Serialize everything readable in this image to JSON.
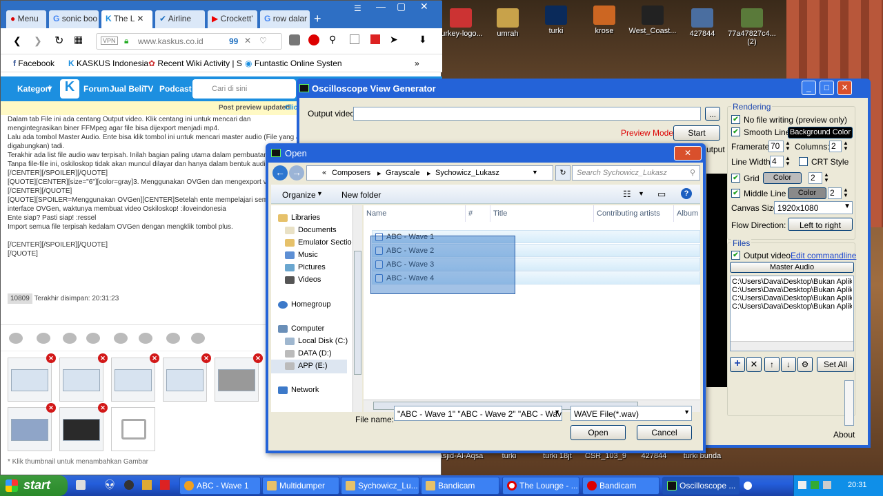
{
  "desktop": {
    "icons_top": [
      "turkey-logo...",
      "umrah",
      "turki",
      "krose",
      "West_Coast...",
      "427844",
      "77a47827c4...\n(2)"
    ],
    "icons_bottom": [
      "asjid-Al-Aqsa",
      "turki",
      "turki 18jt",
      "CSR_103_9",
      "427844",
      "turki bunda"
    ]
  },
  "browser": {
    "tabs": [
      "Menu",
      "sonic boo",
      "The L",
      "Airline",
      "Crockett'",
      "row dalar"
    ],
    "url": "www.kaskus.co.id",
    "count": "99",
    "bookmarks": [
      "Facebook",
      "KASKUS Indonesia",
      "Recent Wiki Activity | S",
      "Funtastic Online Systen"
    ],
    "kaskus_nav": [
      "Kategori",
      "Forum",
      "Jual Beli",
      "TV",
      "Podcast"
    ],
    "search_placeholder": "Cari di sini",
    "notice": "Post preview updated",
    "notice_link": "Click",
    "editor_lines": [
      "Dalam tab File ini ada centang Output video. Klik centang ini untuk mencari dan",
      "mengintegrasikan biner FFMpeg agar file bisa dijexport menjadi mp4.",
      "Lalu ada tombol Master Audio. Ente bisa klik tombol ini untuk mencari master audio (File yang a",
      "digabungkan) tadi.",
      "Terakhir ada list file audio wav terpisah. Inilah bagian paling utama dalam pembuatan",
      "Tanpa file-file ini, oskiloskop tidak akan muncul dilayar dan hanya dalam bentuk audio",
      "[/CENTER][/SPOILER][/QUOTE]",
      "[QUOTE][CENTER][size=\"6\"][color=gray]3. Menggunakan OVGen dan mengexport vid",
      "[/CENTER][/QUOTE]",
      "[QUOTE][SPOILER=Menggunakan OVGen][CENTER]Setelah ente mempelajari semu",
      "interface OVGen, waktunya membuat video Oskiloskop! :iloveindonesia",
      "Ente siap? Pasti siap! :ressel",
      "Import semua file terpisah kedalam OVGen dengan mengklik tombol plus.",
      "",
      "[/CENTER][/SPOILER][/QUOTE]",
      "[/QUOTE]"
    ],
    "char_count": "10809",
    "saved_text": "Terakhir disimpan: 20:31:23",
    "bottom_note": "* Klik thumbnail untuk menambahkan Gambar"
  },
  "osc": {
    "title": "Oscilloscope View Generator",
    "output_video_label": "Output video:",
    "browse_label": "...",
    "preview_mode": "Preview Mode",
    "start_label": "Start",
    "output_clip": "utput",
    "rendering_title": "Rendering",
    "no_file_writing": "No file writing (preview only)",
    "smooth_line": "Smooth Line",
    "background_color": "Background Color",
    "framerate_label": "Framerate:",
    "framerate": "70",
    "columns_label": "Columns:",
    "columns": "2",
    "line_width_label": "Line Width:",
    "line_width": "4",
    "crt_style": "CRT Style",
    "grid_label": "Grid",
    "grid_color": "Color",
    "grid_value": "2",
    "middle_line": "Middle Line",
    "middle_color": "Color",
    "middle_value": "2",
    "canvas_size_label": "Canvas Size:",
    "canvas_size": "1920x1080",
    "flow_direction_label": "Flow Direction:",
    "flow_direction": "Left to right",
    "files_title": "Files",
    "output_video": "Output video",
    "edit_commandline": "Edit commandline",
    "master_audio": "Master Audio",
    "file_list": [
      "C:\\Users\\Dava\\Desktop\\Bukan Aplikasi",
      "C:\\Users\\Dava\\Desktop\\Bukan Aplikasi",
      "C:\\Users\\Dava\\Desktop\\Bukan Aplikasi",
      "C:\\Users\\Dava\\Desktop\\Bukan Aplikasi"
    ],
    "set_all": "Set All",
    "about": "About"
  },
  "dialog": {
    "title": "Open",
    "crumbs": [
      "Composers",
      "Grayscale",
      "Sychowicz_Lukasz"
    ],
    "search_placeholder": "Search Sychowicz_Lukasz",
    "organize": "Organize",
    "new_folder": "New folder",
    "nav": [
      "Libraries",
      "Documents",
      "Emulator Sectio",
      "Music",
      "Pictures",
      "Videos",
      "Homegroup",
      "Computer",
      "Local Disk (C:)",
      "DATA (D:)",
      "APP (E:)",
      "Network"
    ],
    "columns": [
      "Name",
      "#",
      "Title",
      "Contributing artists",
      "Album"
    ],
    "files": [
      "ABC - Wave 1",
      "ABC - Wave 2",
      "ABC - Wave 3",
      "ABC - Wave 4"
    ],
    "file_name_label": "File name:",
    "file_name_value": "\"ABC - Wave 1\" \"ABC - Wave 2\" \"ABC - Wave",
    "file_type": "WAVE File(*.wav)",
    "open_label": "Open",
    "cancel_label": "Cancel"
  },
  "taskbar": {
    "start": "start",
    "tasks": [
      "ABC - Wave 1",
      "Multidumper",
      "Sychowicz_Lu...",
      "Bandicam",
      "The Lounge - ...",
      "Bandicam",
      "Oscilloscope ..."
    ],
    "clock": "20:31"
  }
}
